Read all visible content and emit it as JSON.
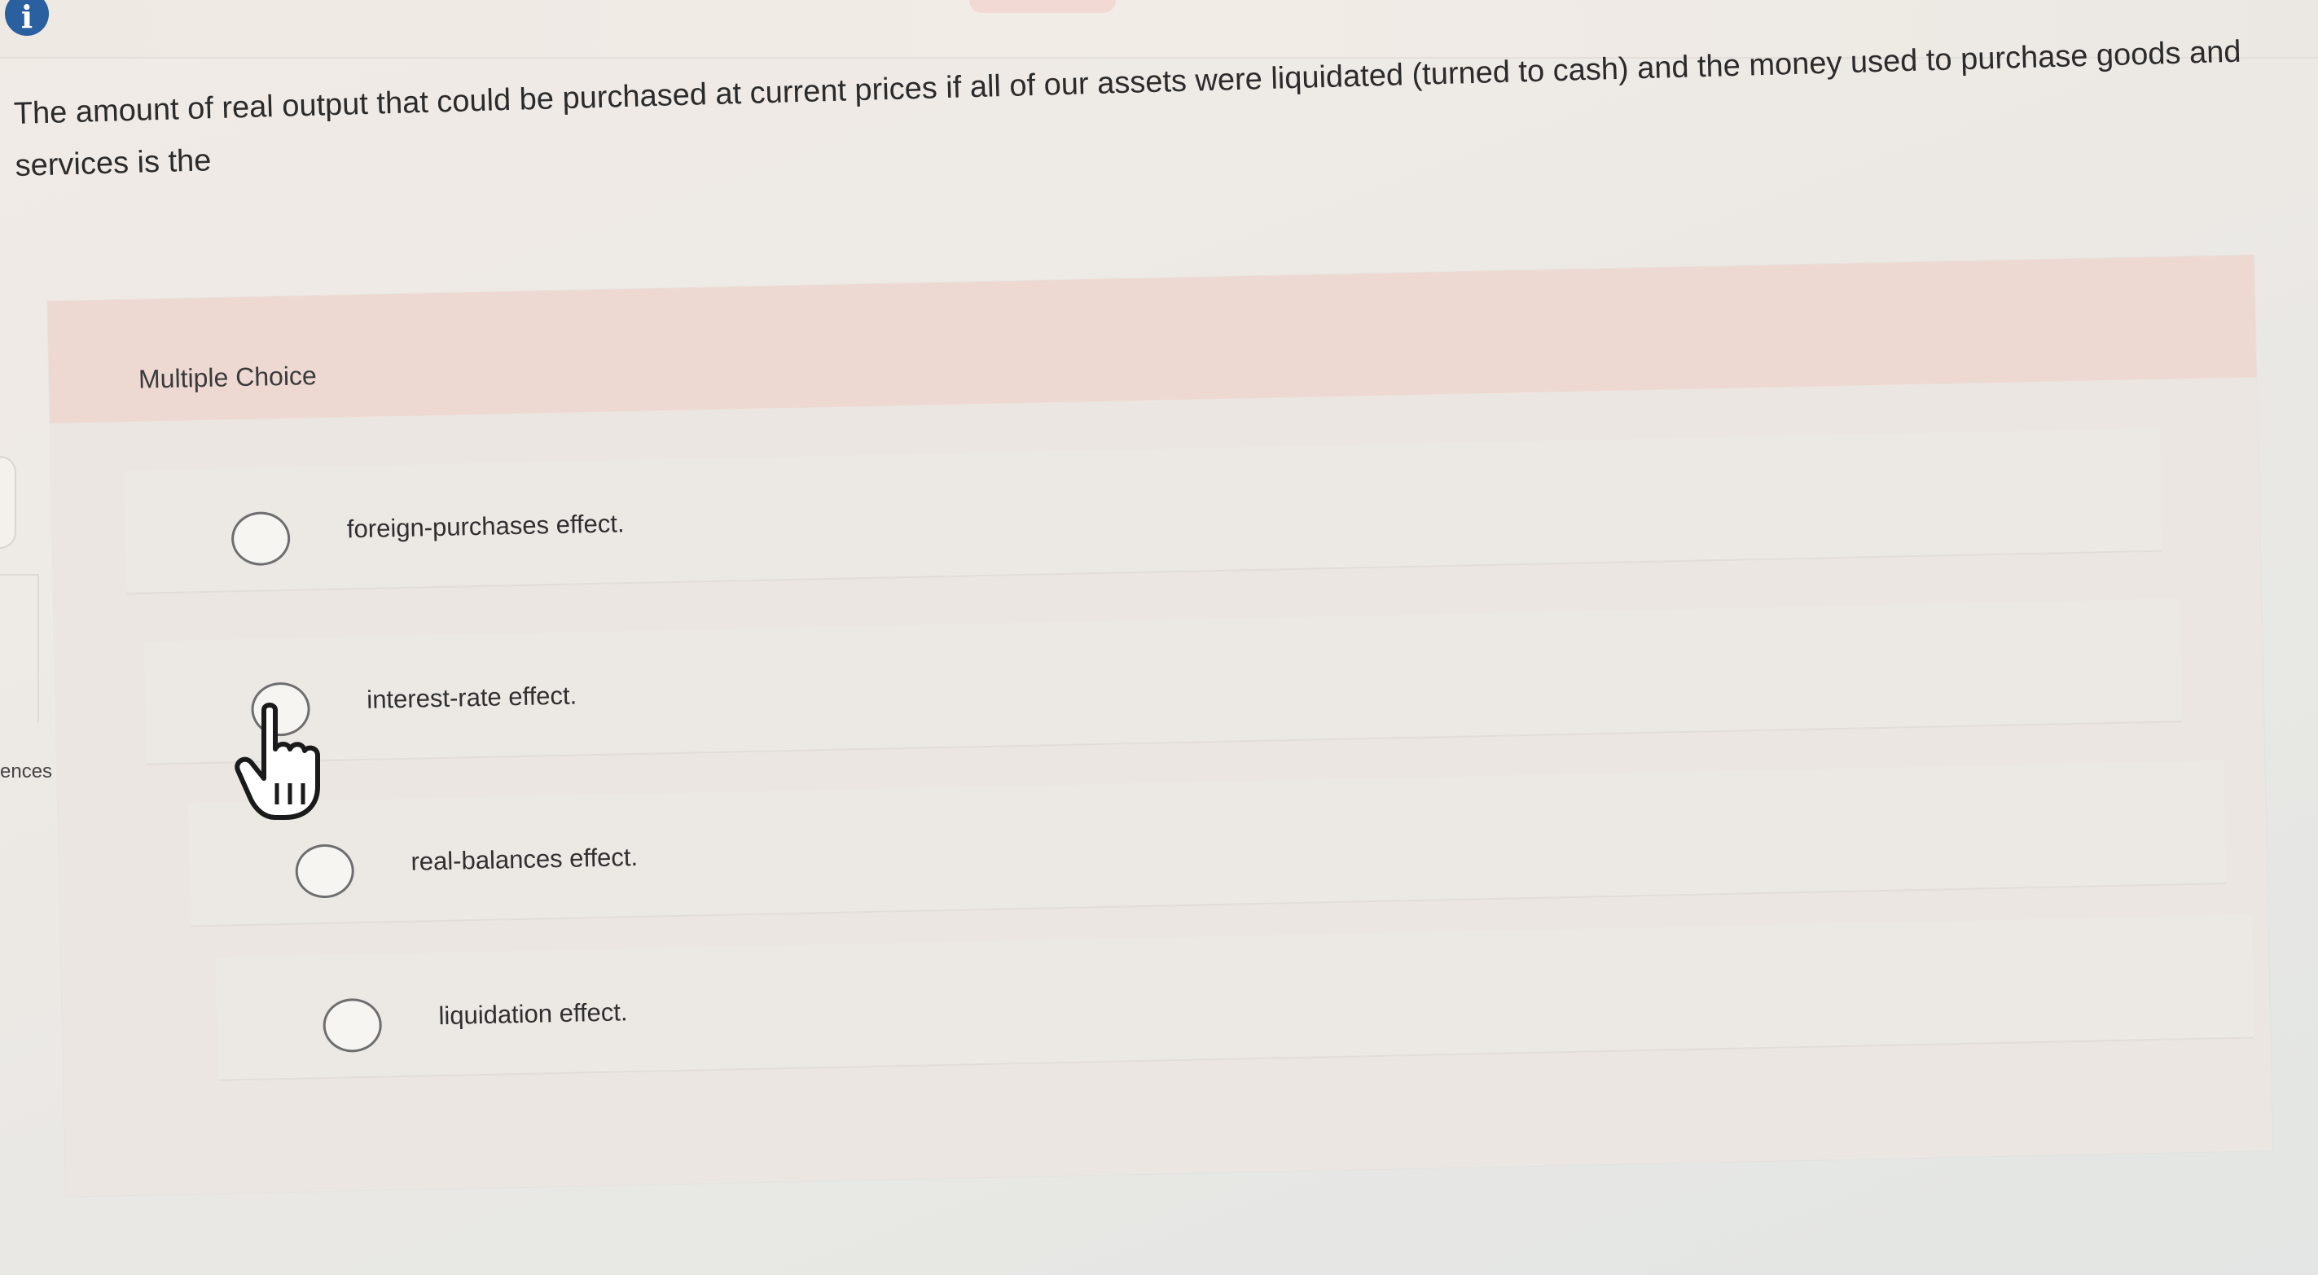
{
  "header": {
    "info_icon_glyph": "i"
  },
  "sidebar": {
    "partial_label": "ences"
  },
  "question": {
    "text": "The amount of real output that could be purchased at current prices if all of our assets were liquidated (turned to cash) and the money used to purchase goods and services is the"
  },
  "multiple_choice": {
    "label": "Multiple Choice",
    "options": [
      {
        "label": "foreign-purchases effect.",
        "selected": false
      },
      {
        "label": "interest-rate effect.",
        "selected": false
      },
      {
        "label": "real-balances effect.",
        "selected": false
      },
      {
        "label": "liquidation effect.",
        "selected": false
      }
    ]
  },
  "colors": {
    "info_icon": "#2a5fa0",
    "header_band": "#eed9d2",
    "card_bg": "#ebe6e1"
  },
  "icons": {
    "info": "info-icon",
    "cursor": "hand-pointer-icon"
  }
}
